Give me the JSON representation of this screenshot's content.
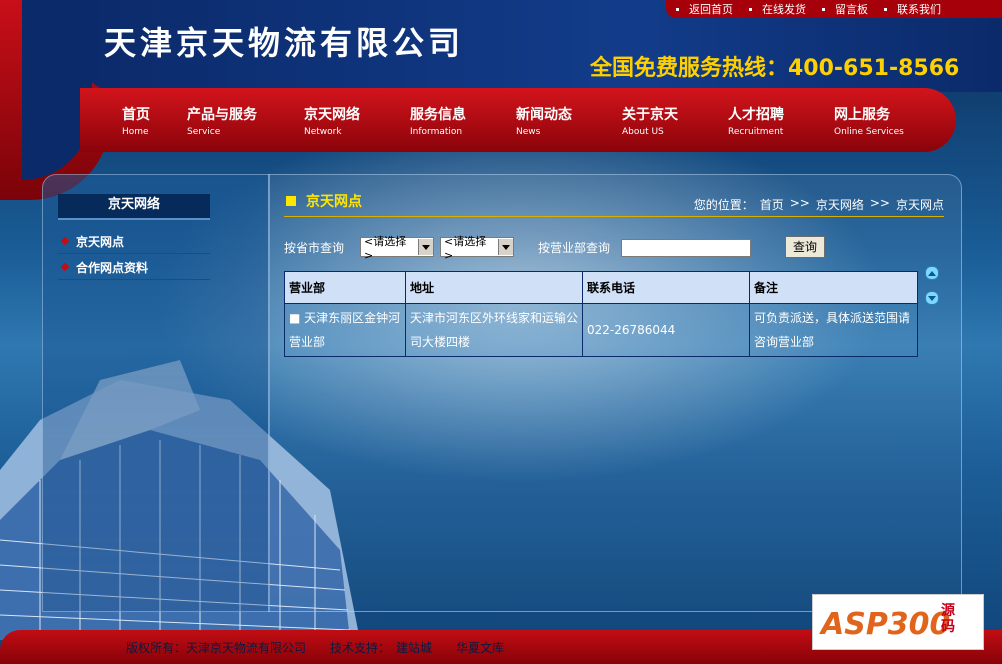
{
  "header": {
    "company_name": "天津京天物流有限公司",
    "hotline": "全国免费服务热线：400-651-8566",
    "top_links": [
      "返回首页",
      "在线发货",
      "留言板",
      "联系我们"
    ]
  },
  "nav": [
    {
      "cn": "首页",
      "en": "Home"
    },
    {
      "cn": "产品与服务",
      "en": "Service"
    },
    {
      "cn": "京天网络",
      "en": "Network"
    },
    {
      "cn": "服务信息",
      "en": "Information"
    },
    {
      "cn": "新闻动态",
      "en": "News"
    },
    {
      "cn": "关于京天",
      "en": "About US"
    },
    {
      "cn": "人才招聘",
      "en": "Recruitment"
    },
    {
      "cn": "网上服务",
      "en": "Online Services"
    }
  ],
  "sidebar": {
    "title": "京天网络",
    "items": [
      "京天网点",
      "合作网点资料"
    ]
  },
  "main": {
    "title": "京天网点",
    "breadcrumb_prefix": "您的位置：",
    "breadcrumb": [
      "首页",
      "京天网络",
      "京天网点"
    ],
    "breadcrumb_sep": ">>",
    "query_province_label": "按省市查询",
    "select_placeholder": "<请选择>",
    "query_branch_label": "按营业部查询",
    "search_button": "查询",
    "table": {
      "headers": [
        "营业部",
        "地址",
        "联系电话",
        "备注"
      ],
      "rows": [
        [
          "■  天津东丽区金钟河营业部",
          "天津市河东区外环线家和运输公司大楼四楼",
          "022-26786044",
          "可负责派送，具体派送范围请咨询营业部"
        ]
      ]
    }
  },
  "footer": {
    "copyright": "版权所有：天津京天物流有限公司",
    "tech_label": "技术支持：",
    "tech_link": "建站城",
    "library_link": "华夏文库"
  },
  "logo": {
    "main": "ASP300",
    "sub": "源码"
  }
}
